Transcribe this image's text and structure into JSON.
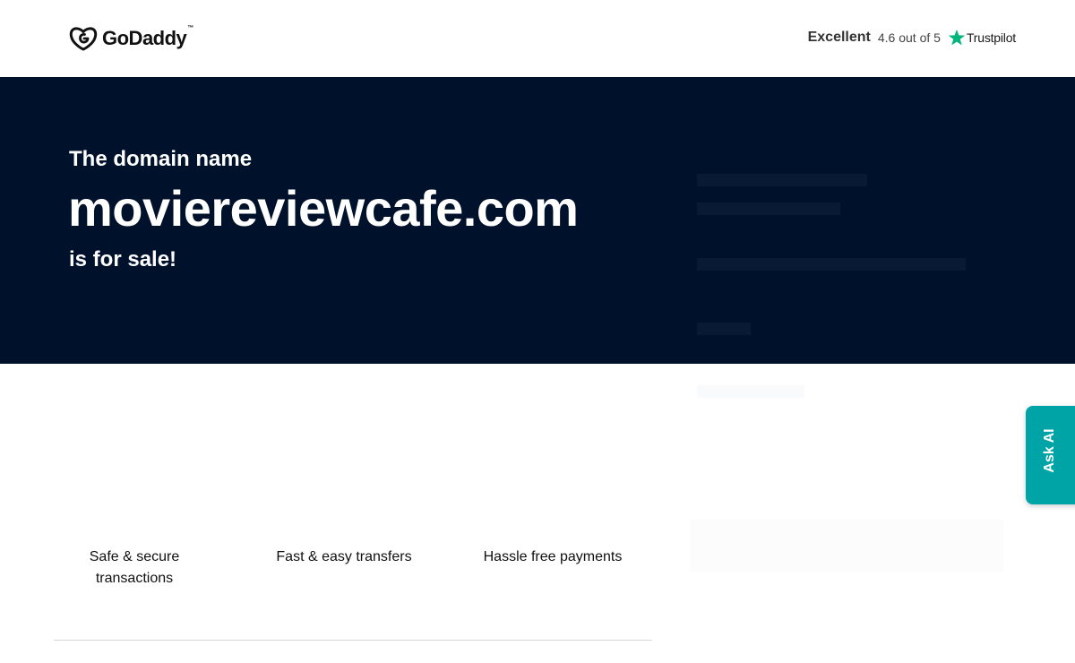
{
  "header": {
    "logo_text": "GoDaddy",
    "logo_tm": "™",
    "trust": {
      "rating_word": "Excellent",
      "score_text": "4.6 out of 5",
      "brand": "Trustpilot",
      "star_color": "#00b67a"
    }
  },
  "hero": {
    "line1": "The domain name",
    "domain": "moviereviewcafe.com",
    "line3": "is for sale!",
    "background_color": "#00112b"
  },
  "features": [
    {
      "label": "Safe & secure transactions"
    },
    {
      "label": "Fast & easy transfers"
    },
    {
      "label": "Hassle free payments"
    }
  ],
  "ask_ai": {
    "label": "Ask AI",
    "color": "#00a4a6"
  },
  "icons": {
    "logo": "godaddy-logo-icon",
    "star": "trustpilot-star-icon"
  }
}
